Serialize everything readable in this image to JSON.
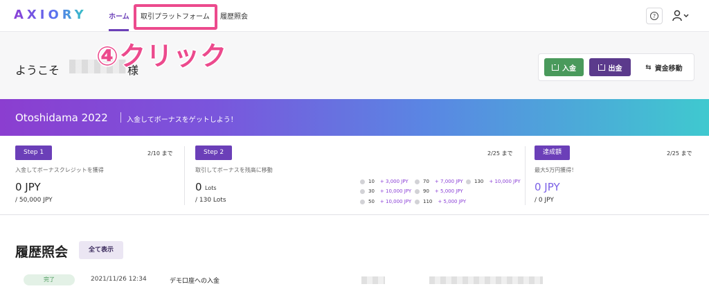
{
  "header": {
    "logo": "AXIORY",
    "nav": {
      "home": "ホーム",
      "platform": "取引プラットフォーム",
      "history": "履歴照会"
    }
  },
  "annotation": {
    "step4": "④クリック"
  },
  "welcome": {
    "greeting_prefix": "ようこそ",
    "greeting_suffix": "様"
  },
  "actions": {
    "deposit": "入金",
    "withdraw": "出金",
    "transfer": "資金移動"
  },
  "banner": {
    "title": "Otoshidama 2022",
    "subtitle": "入金してボーナスをゲットしよう！"
  },
  "steps": [
    {
      "badge": "Step 1",
      "due": "2/10 まで",
      "desc": "入金してボーナスクレジットを獲得",
      "value": "0 JPY",
      "of": "/ 50,000 JPY"
    },
    {
      "badge": "Step 2",
      "due": "2/25 まで",
      "desc": "取引してボーナスを残高に移動",
      "value": "0",
      "value_unit": "Lots",
      "of": "/ 130 Lots",
      "bonus_tiers": [
        {
          "lots": "10",
          "bonus": "+ 3,000 JPY"
        },
        {
          "lots": "30",
          "bonus": "+ 10,000 JPY"
        },
        {
          "lots": "50",
          "bonus": "+ 10,000 JPY"
        },
        {
          "lots": "70",
          "bonus": "+ 7,000 JPY"
        },
        {
          "lots": "90",
          "bonus": "+ 5,000 JPY"
        },
        {
          "lots": "110",
          "bonus": "+ 5,000 JPY"
        },
        {
          "lots": "130",
          "bonus": "+ 10,000 JPY"
        }
      ]
    },
    {
      "badge": "達成額",
      "due": "2/25 まで",
      "desc": "最大5万円獲得！",
      "value": "0 JPY",
      "of": "/ 0 JPY"
    }
  ],
  "history": {
    "title": "履歴照会",
    "show_all": "全て表示",
    "row": {
      "status": "完了",
      "datetime": "2021/11/26 12:34",
      "description": "デモ口座への入金"
    }
  },
  "colors": {
    "accent": "#6b3fb8",
    "deposit": "#4a9a5c",
    "annotation": "#ec4a8d"
  }
}
